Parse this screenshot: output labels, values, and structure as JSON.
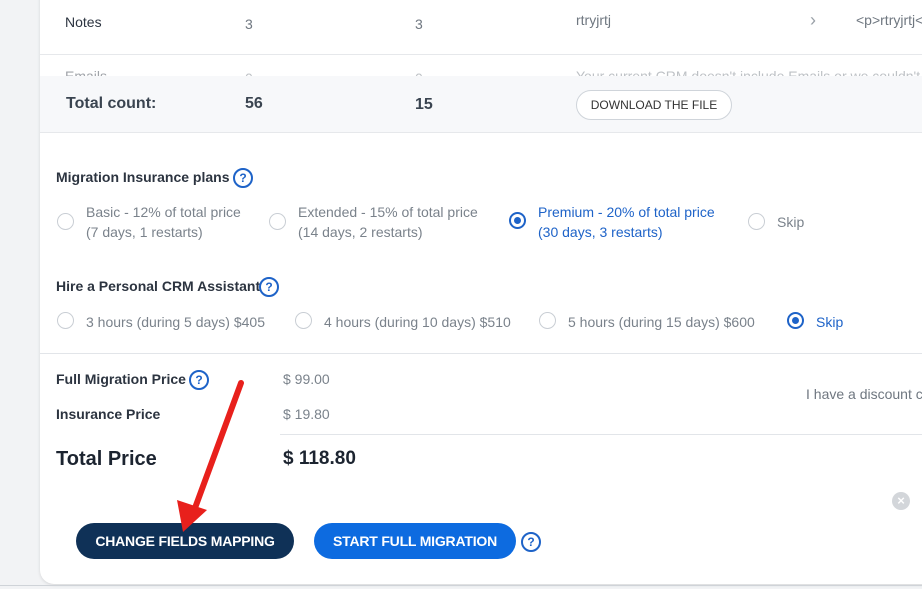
{
  "table": {
    "rows": [
      {
        "entity": "Notes",
        "col2": "3",
        "col3": "3",
        "comment": "rtryjrtj",
        "value": "<p>rtryjrtj<"
      },
      {
        "entity": "Emails",
        "col2": "0",
        "col3": "0",
        "comment": "Your current CRM doesn't include Emails or we couldn't",
        "value": ""
      }
    ],
    "total": {
      "label": "Total count:",
      "col2": "56",
      "col3": "15",
      "download_label": "DOWNLOAD THE FILE"
    }
  },
  "insurance": {
    "title": "Migration Insurance plans",
    "options": [
      {
        "line1": "Basic - 12% of total price",
        "line2": "(7 days, 1 restarts)",
        "selected": false
      },
      {
        "line1": "Extended - 15% of total price",
        "line2": "(14 days, 2 restarts)",
        "selected": false
      },
      {
        "line1": "Premium - 20% of total price",
        "line2": "(30 days, 3 restarts)",
        "selected": true
      },
      {
        "line1": "Skip",
        "line2": "",
        "selected": false
      }
    ]
  },
  "assistant": {
    "title": "Hire a Personal CRM Assistant",
    "options": [
      {
        "label": "3 hours (during 5 days) $405",
        "selected": false
      },
      {
        "label": "4 hours (during 10 days) $510",
        "selected": false
      },
      {
        "label": "5 hours (during 15 days) $600",
        "selected": false
      },
      {
        "label": "Skip",
        "selected": true
      }
    ]
  },
  "pricing": {
    "full_migration_label": "Full Migration Price",
    "full_migration_value": "$ 99.00",
    "insurance_label": "Insurance Price",
    "insurance_value": "$ 19.80",
    "discount_text": "I have a discount c",
    "total_label": "Total Price",
    "total_value": "$ 118.80"
  },
  "actions": {
    "change_mapping": "CHANGE FIELDS MAPPING",
    "start_migration": "START FULL MIGRATION"
  },
  "icons": {
    "help": "?",
    "chevron": "›",
    "close": "×"
  },
  "colors": {
    "accent": "#1e63c8",
    "dark_button": "#0f3157",
    "blue_button": "#0d6be0",
    "annotation_arrow": "#e8201c"
  }
}
